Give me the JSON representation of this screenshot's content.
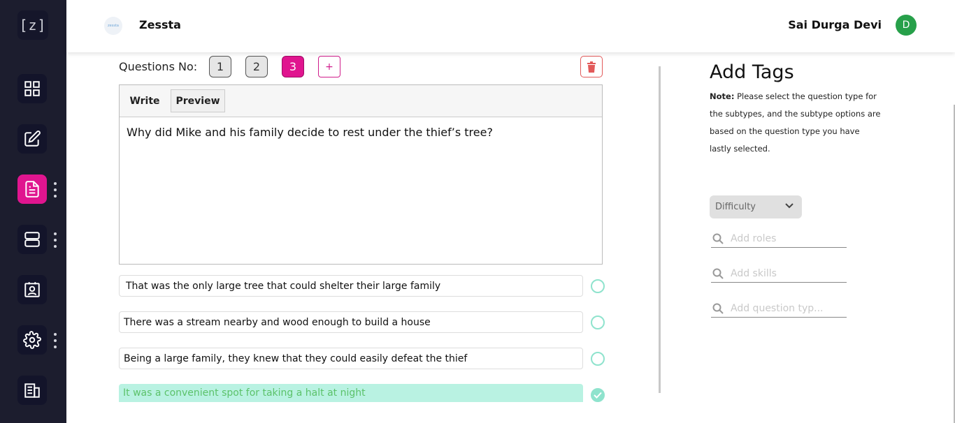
{
  "app": {
    "logo_text": "[z]",
    "brand_logo_text": "zessta",
    "brand_name": "Zessta"
  },
  "user": {
    "name": "Sai Durga Devi",
    "avatar_initial": "D"
  },
  "sidebar": {
    "items": [
      {
        "name": "grid-icon",
        "active": false
      },
      {
        "name": "edit-icon",
        "active": false
      },
      {
        "name": "document-icon",
        "active": true
      },
      {
        "name": "server-icon",
        "active": false
      },
      {
        "name": "contact-card-icon",
        "active": false
      },
      {
        "name": "gear-icon",
        "active": false
      },
      {
        "name": "building-icon",
        "active": false
      }
    ]
  },
  "questions": {
    "label": "Questions No:",
    "numbers": [
      "1",
      "2",
      "3"
    ],
    "active": "3",
    "add_label": "+"
  },
  "editor": {
    "tabs": {
      "write": "Write",
      "preview": "Preview"
    },
    "text": "Why did Mike and his family decide to rest under the thief’s tree?"
  },
  "options": [
    {
      "text": "That was the only large tree that could shelter their large family",
      "correct": false
    },
    {
      "text": "There was a stream nearby and wood enough to build a house",
      "correct": false
    },
    {
      "text": "Being a large family, they knew that they could easily defeat the thief",
      "correct": false
    },
    {
      "text": "It was a convenient spot for taking a halt at night",
      "correct": true
    }
  ],
  "tags": {
    "title": "Add Tags",
    "note_label": "Note:",
    "note_text": " Please select the question type for the subtypes, and the subtype options are based on the question type you have lastly selected.",
    "difficulty_label": "Difficulty",
    "roles_placeholder": "Add roles",
    "skills_placeholder": "Add skills",
    "question_type_placeholder": "Add question typ..."
  },
  "colors": {
    "sidebar": "#1c1d2e",
    "accent": "#e0158f",
    "correct_bg": "#b9f2e2",
    "correct_text": "#5cc26a",
    "avatar": "#27a04a"
  }
}
